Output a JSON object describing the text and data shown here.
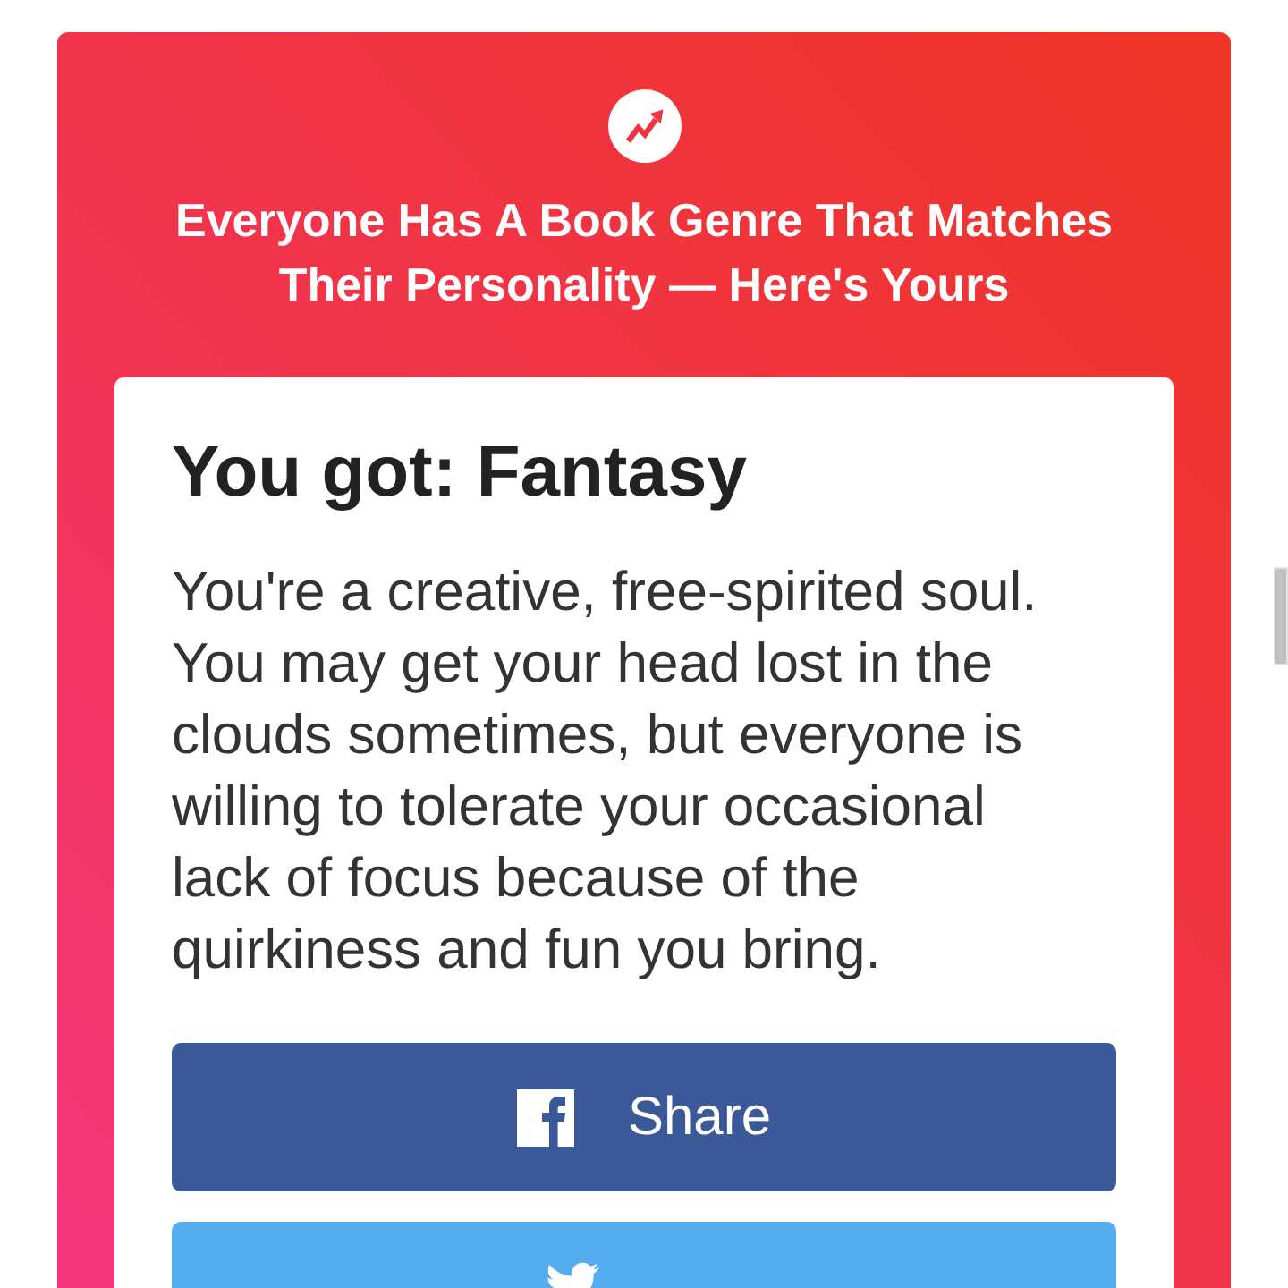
{
  "header": {
    "title": "Everyone Has A Book Genre That Matches Their Personality — Here's Yours"
  },
  "result": {
    "heading": "You got: Fantasy",
    "description": "You're a creative, free-spirited soul. You may get your head lost in the clouds sometimes, but everyone is willing to tolerate your occasional lack of focus because of the quirkiness and fun you bring."
  },
  "share_buttons": [
    {
      "kind": "facebook",
      "label": "Share"
    },
    {
      "kind": "twitter"
    }
  ]
}
